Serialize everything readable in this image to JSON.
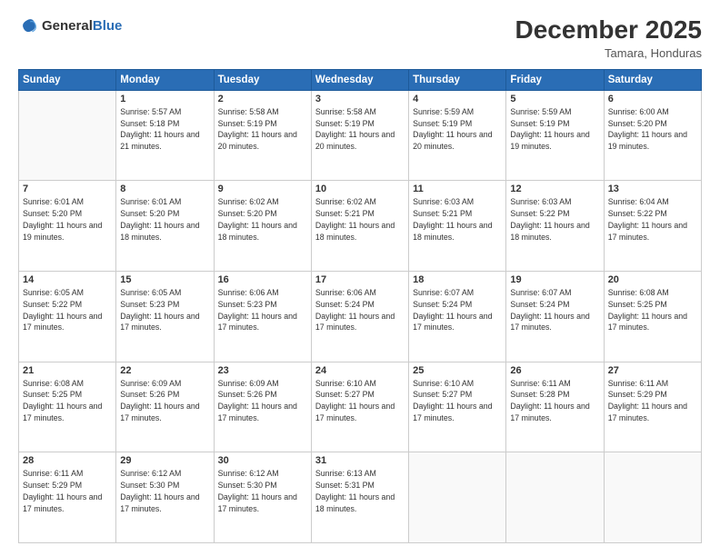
{
  "logo": {
    "text1": "General",
    "text2": "Blue"
  },
  "header": {
    "month_year": "December 2025",
    "location": "Tamara, Honduras"
  },
  "days_of_week": [
    "Sunday",
    "Monday",
    "Tuesday",
    "Wednesday",
    "Thursday",
    "Friday",
    "Saturday"
  ],
  "weeks": [
    [
      {
        "day": "",
        "sunrise": "",
        "sunset": "",
        "daylight": "",
        "empty": true
      },
      {
        "day": "1",
        "sunrise": "Sunrise: 5:57 AM",
        "sunset": "Sunset: 5:18 PM",
        "daylight": "Daylight: 11 hours and 21 minutes."
      },
      {
        "day": "2",
        "sunrise": "Sunrise: 5:58 AM",
        "sunset": "Sunset: 5:19 PM",
        "daylight": "Daylight: 11 hours and 20 minutes."
      },
      {
        "day": "3",
        "sunrise": "Sunrise: 5:58 AM",
        "sunset": "Sunset: 5:19 PM",
        "daylight": "Daylight: 11 hours and 20 minutes."
      },
      {
        "day": "4",
        "sunrise": "Sunrise: 5:59 AM",
        "sunset": "Sunset: 5:19 PM",
        "daylight": "Daylight: 11 hours and 20 minutes."
      },
      {
        "day": "5",
        "sunrise": "Sunrise: 5:59 AM",
        "sunset": "Sunset: 5:19 PM",
        "daylight": "Daylight: 11 hours and 19 minutes."
      },
      {
        "day": "6",
        "sunrise": "Sunrise: 6:00 AM",
        "sunset": "Sunset: 5:20 PM",
        "daylight": "Daylight: 11 hours and 19 minutes."
      }
    ],
    [
      {
        "day": "7",
        "sunrise": "Sunrise: 6:01 AM",
        "sunset": "Sunset: 5:20 PM",
        "daylight": "Daylight: 11 hours and 19 minutes."
      },
      {
        "day": "8",
        "sunrise": "Sunrise: 6:01 AM",
        "sunset": "Sunset: 5:20 PM",
        "daylight": "Daylight: 11 hours and 18 minutes."
      },
      {
        "day": "9",
        "sunrise": "Sunrise: 6:02 AM",
        "sunset": "Sunset: 5:20 PM",
        "daylight": "Daylight: 11 hours and 18 minutes."
      },
      {
        "day": "10",
        "sunrise": "Sunrise: 6:02 AM",
        "sunset": "Sunset: 5:21 PM",
        "daylight": "Daylight: 11 hours and 18 minutes."
      },
      {
        "day": "11",
        "sunrise": "Sunrise: 6:03 AM",
        "sunset": "Sunset: 5:21 PM",
        "daylight": "Daylight: 11 hours and 18 minutes."
      },
      {
        "day": "12",
        "sunrise": "Sunrise: 6:03 AM",
        "sunset": "Sunset: 5:22 PM",
        "daylight": "Daylight: 11 hours and 18 minutes."
      },
      {
        "day": "13",
        "sunrise": "Sunrise: 6:04 AM",
        "sunset": "Sunset: 5:22 PM",
        "daylight": "Daylight: 11 hours and 17 minutes."
      }
    ],
    [
      {
        "day": "14",
        "sunrise": "Sunrise: 6:05 AM",
        "sunset": "Sunset: 5:22 PM",
        "daylight": "Daylight: 11 hours and 17 minutes."
      },
      {
        "day": "15",
        "sunrise": "Sunrise: 6:05 AM",
        "sunset": "Sunset: 5:23 PM",
        "daylight": "Daylight: 11 hours and 17 minutes."
      },
      {
        "day": "16",
        "sunrise": "Sunrise: 6:06 AM",
        "sunset": "Sunset: 5:23 PM",
        "daylight": "Daylight: 11 hours and 17 minutes."
      },
      {
        "day": "17",
        "sunrise": "Sunrise: 6:06 AM",
        "sunset": "Sunset: 5:24 PM",
        "daylight": "Daylight: 11 hours and 17 minutes."
      },
      {
        "day": "18",
        "sunrise": "Sunrise: 6:07 AM",
        "sunset": "Sunset: 5:24 PM",
        "daylight": "Daylight: 11 hours and 17 minutes."
      },
      {
        "day": "19",
        "sunrise": "Sunrise: 6:07 AM",
        "sunset": "Sunset: 5:24 PM",
        "daylight": "Daylight: 11 hours and 17 minutes."
      },
      {
        "day": "20",
        "sunrise": "Sunrise: 6:08 AM",
        "sunset": "Sunset: 5:25 PM",
        "daylight": "Daylight: 11 hours and 17 minutes."
      }
    ],
    [
      {
        "day": "21",
        "sunrise": "Sunrise: 6:08 AM",
        "sunset": "Sunset: 5:25 PM",
        "daylight": "Daylight: 11 hours and 17 minutes."
      },
      {
        "day": "22",
        "sunrise": "Sunrise: 6:09 AM",
        "sunset": "Sunset: 5:26 PM",
        "daylight": "Daylight: 11 hours and 17 minutes."
      },
      {
        "day": "23",
        "sunrise": "Sunrise: 6:09 AM",
        "sunset": "Sunset: 5:26 PM",
        "daylight": "Daylight: 11 hours and 17 minutes."
      },
      {
        "day": "24",
        "sunrise": "Sunrise: 6:10 AM",
        "sunset": "Sunset: 5:27 PM",
        "daylight": "Daylight: 11 hours and 17 minutes."
      },
      {
        "day": "25",
        "sunrise": "Sunrise: 6:10 AM",
        "sunset": "Sunset: 5:27 PM",
        "daylight": "Daylight: 11 hours and 17 minutes."
      },
      {
        "day": "26",
        "sunrise": "Sunrise: 6:11 AM",
        "sunset": "Sunset: 5:28 PM",
        "daylight": "Daylight: 11 hours and 17 minutes."
      },
      {
        "day": "27",
        "sunrise": "Sunrise: 6:11 AM",
        "sunset": "Sunset: 5:29 PM",
        "daylight": "Daylight: 11 hours and 17 minutes."
      }
    ],
    [
      {
        "day": "28",
        "sunrise": "Sunrise: 6:11 AM",
        "sunset": "Sunset: 5:29 PM",
        "daylight": "Daylight: 11 hours and 17 minutes."
      },
      {
        "day": "29",
        "sunrise": "Sunrise: 6:12 AM",
        "sunset": "Sunset: 5:30 PM",
        "daylight": "Daylight: 11 hours and 17 minutes."
      },
      {
        "day": "30",
        "sunrise": "Sunrise: 6:12 AM",
        "sunset": "Sunset: 5:30 PM",
        "daylight": "Daylight: 11 hours and 17 minutes."
      },
      {
        "day": "31",
        "sunrise": "Sunrise: 6:13 AM",
        "sunset": "Sunset: 5:31 PM",
        "daylight": "Daylight: 11 hours and 18 minutes."
      },
      {
        "day": "",
        "sunrise": "",
        "sunset": "",
        "daylight": "",
        "empty": true
      },
      {
        "day": "",
        "sunrise": "",
        "sunset": "",
        "daylight": "",
        "empty": true
      },
      {
        "day": "",
        "sunrise": "",
        "sunset": "",
        "daylight": "",
        "empty": true
      }
    ]
  ]
}
